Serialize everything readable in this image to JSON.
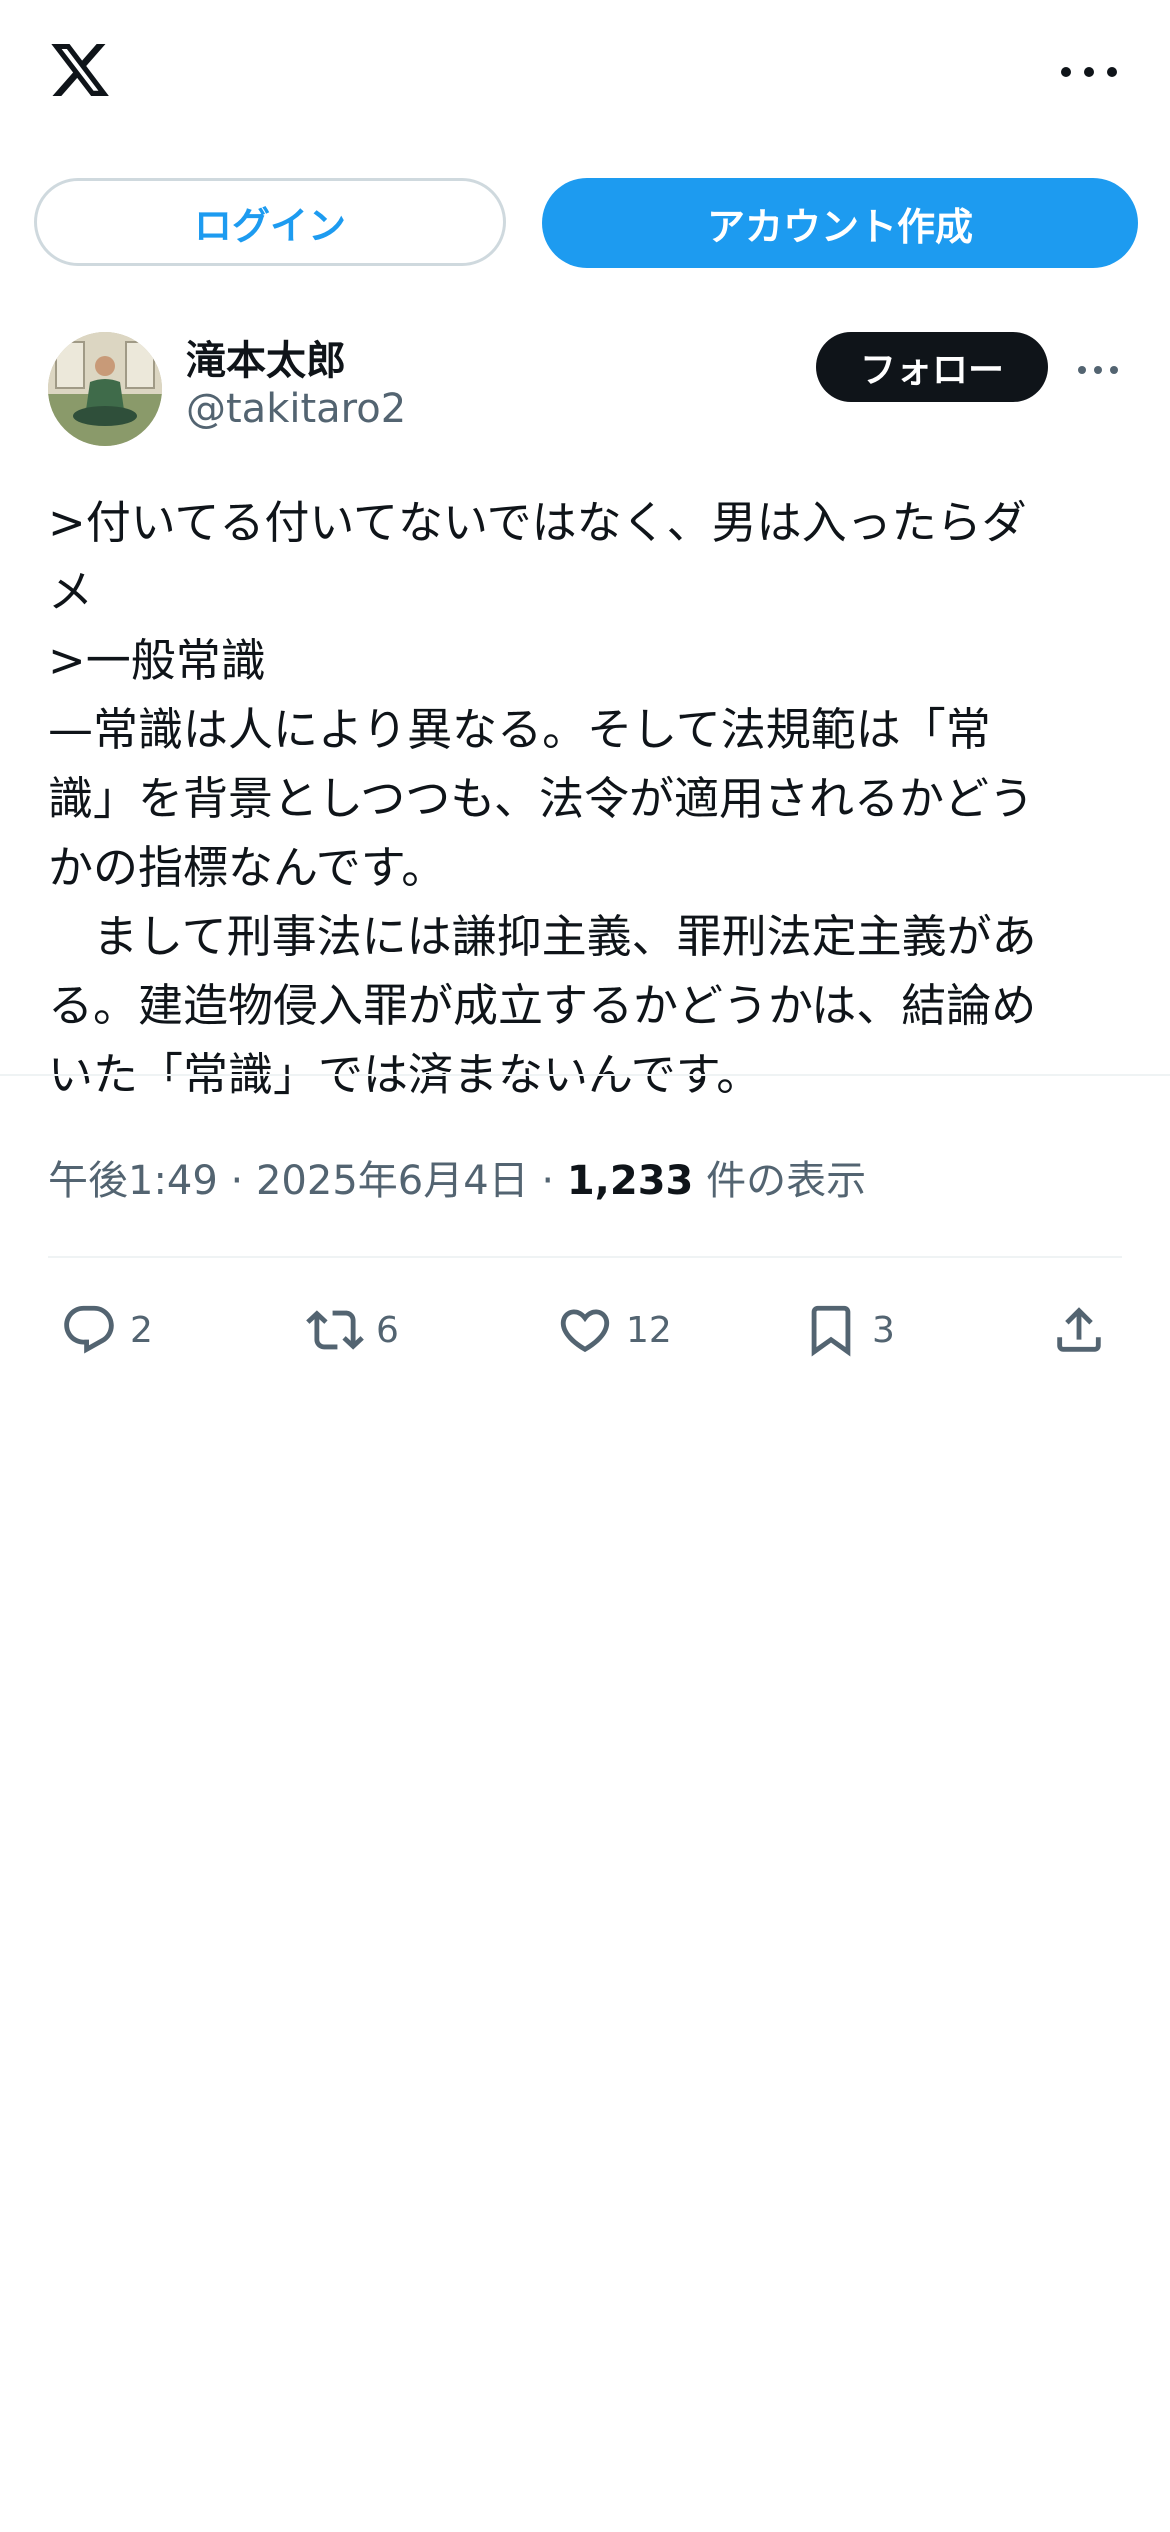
{
  "header": {
    "logo_icon": "x-logo-icon",
    "more_icon": "more-horizontal-icon"
  },
  "auth": {
    "login_label": "ログイン",
    "signup_label": "アカウント作成"
  },
  "post": {
    "author": {
      "display_name": "滝本太郎",
      "handle": "@takitaro2"
    },
    "follow_label": "フォロー",
    "text": ">付いてる付いてないではなく、男は入ったらダ\nメ\n>一般常識\n—常識は人により異なる。そして法規範は「常\n識」を背景としつつも、法令が適用されるかどう\nかの指標なんです。\n　まして刑事法には謙抑主義、罪刑法定主義があ\nる。建造物侵入罪が成立するかどうかは、結論め\nいた「常識」では済まないんです。",
    "time": "午後1:49",
    "separator": "·",
    "date": "2025年6月4日",
    "views_count": "1,233",
    "views_label": "件の表示",
    "actions": {
      "replies": "2",
      "reposts": "6",
      "likes": "12",
      "bookmarks": "3"
    }
  },
  "colors": {
    "accent": "#1d9bf0",
    "text": "#0f1419",
    "secondary": "#536471",
    "border": "#cfd9de"
  }
}
